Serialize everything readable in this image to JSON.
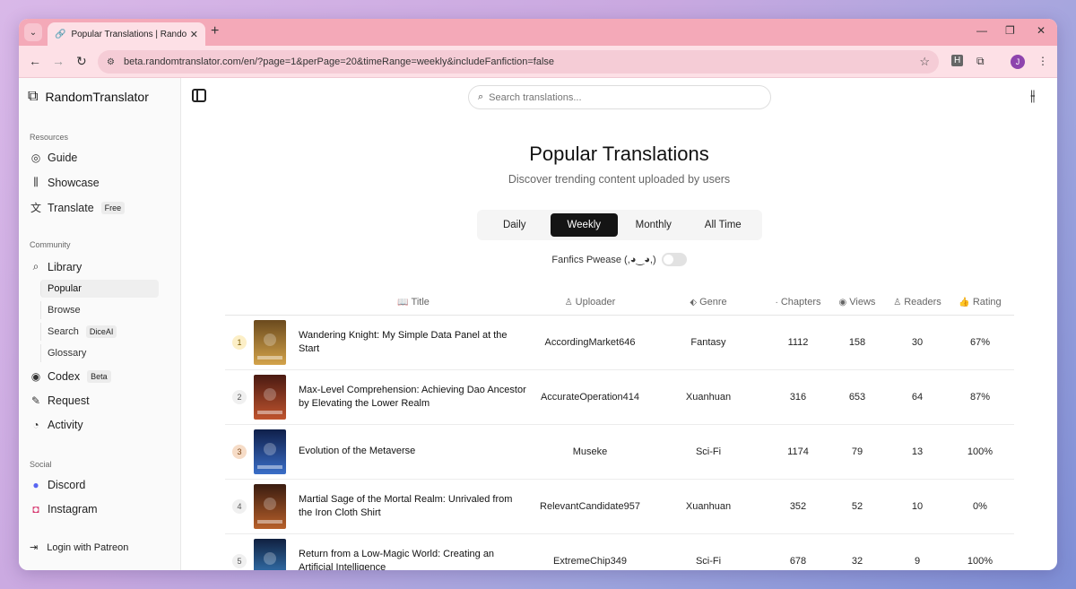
{
  "browser": {
    "tab_title": "Popular Translations | RandomTr",
    "url": "beta.randomtranslator.com/en/?page=1&perPage=20&timeRange=weekly&includeFanfiction=false",
    "profile_initial": "J"
  },
  "sidebar": {
    "brand": "RandomTranslator",
    "resources_label": "Resources",
    "resources": [
      {
        "label": "Guide"
      },
      {
        "label": "Showcase"
      },
      {
        "label": "Translate",
        "badge": "Free"
      }
    ],
    "community_label": "Community",
    "library_label": "Library",
    "library_items": [
      {
        "label": "Popular"
      },
      {
        "label": "Browse"
      },
      {
        "label": "Search",
        "badge": "DiceAI"
      },
      {
        "label": "Glossary"
      }
    ],
    "community": [
      {
        "label": "Codex",
        "badge": "Beta"
      },
      {
        "label": "Request"
      },
      {
        "label": "Activity"
      }
    ],
    "social_label": "Social",
    "social": [
      {
        "label": "Discord"
      },
      {
        "label": "Instagram"
      }
    ],
    "login_label": "Login with Patreon"
  },
  "main": {
    "search_placeholder": "Search translations...",
    "title": "Popular Translations",
    "subtitle": "Discover trending content uploaded by users",
    "period_tabs": [
      "Daily",
      "Weekly",
      "Monthly",
      "All Time"
    ],
    "active_period": "Weekly",
    "fanfic_label": "Fanfics Pwease (,◕‿◕,)",
    "fanfic_enabled": false
  },
  "table": {
    "headers": {
      "title": "Title",
      "uploader": "Uploader",
      "genre": "Genre",
      "chapters": "Chapters",
      "views": "Views",
      "readers": "Readers",
      "rating": "Rating"
    },
    "rows": [
      {
        "rank": "1",
        "title": "Wandering Knight: My Simple Data Panel at the Start",
        "uploader": "AccordingMarket646",
        "genre": "Fantasy",
        "chapters": "1112",
        "views": "158",
        "readers": "30",
        "rating": "67%",
        "cover_colors": [
          "#6b4a1e",
          "#d3a34a"
        ]
      },
      {
        "rank": "2",
        "title": "Max-Level Comprehension: Achieving Dao Ancestor by Elevating the Lower Realm",
        "uploader": "AccurateOperation414",
        "genre": "Xuanhuan",
        "chapters": "316",
        "views": "653",
        "readers": "64",
        "rating": "87%",
        "cover_colors": [
          "#4a1a12",
          "#c0542e"
        ]
      },
      {
        "rank": "3",
        "title": "Evolution of the Metaverse",
        "uploader": "Museke",
        "genre": "Sci-Fi",
        "chapters": "1174",
        "views": "79",
        "readers": "13",
        "rating": "100%",
        "cover_colors": [
          "#0f1f4a",
          "#3a6ec8"
        ]
      },
      {
        "rank": "4",
        "title": "Martial Sage of the Mortal Realm: Unrivaled from the Iron Cloth Shirt",
        "uploader": "RelevantCandidate957",
        "genre": "Xuanhuan",
        "chapters": "352",
        "views": "52",
        "readers": "10",
        "rating": "0%",
        "cover_colors": [
          "#3a1c10",
          "#b8602a"
        ]
      },
      {
        "rank": "5",
        "title": "Return from a Low-Magic World: Creating an Artificial Intelligence",
        "uploader": "ExtremeChip349",
        "genre": "Sci-Fi",
        "chapters": "678",
        "views": "32",
        "readers": "9",
        "rating": "100%",
        "cover_colors": [
          "#102040",
          "#3c86c8"
        ]
      }
    ]
  }
}
